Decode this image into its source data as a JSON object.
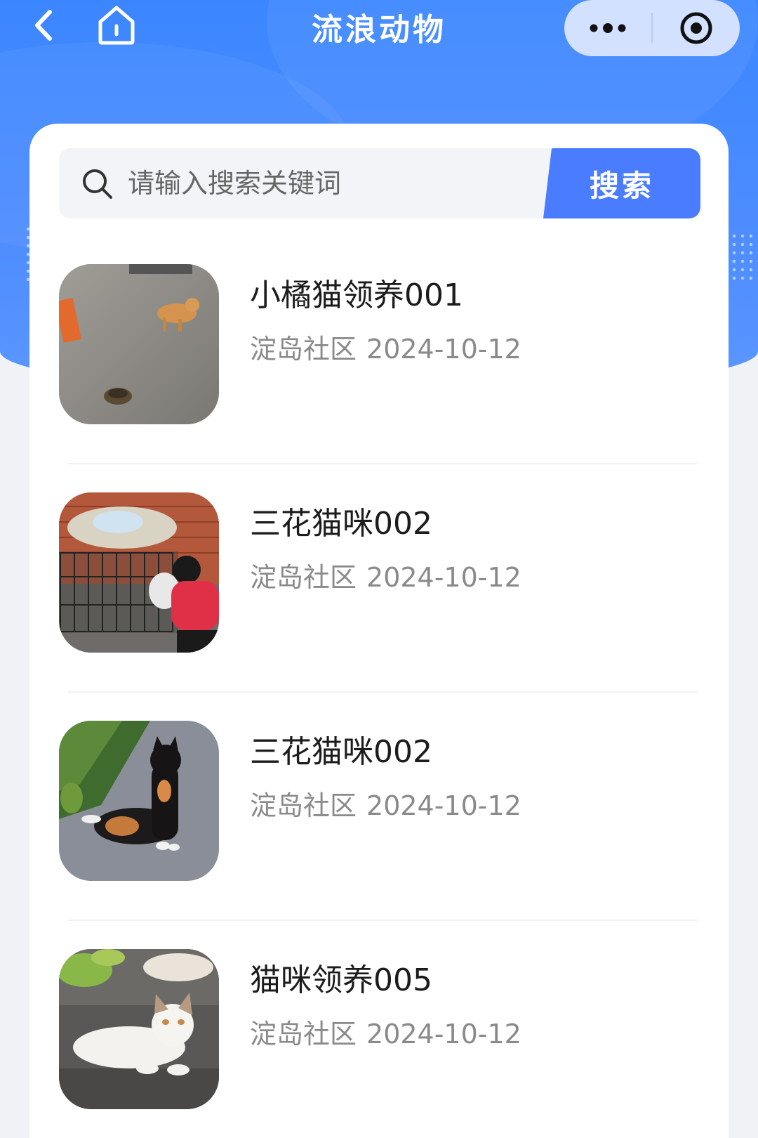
{
  "navbar": {
    "title": "流浪动物",
    "back_icon": "chevron-left-icon",
    "home_icon": "home-icon",
    "more_icon": "more-dots-icon",
    "close_icon": "record-target-icon"
  },
  "colors": {
    "header_blue": "#3b86ff",
    "search_button": "#4a7cff",
    "title_text": "#1c1c1c",
    "meta_text": "#8a8a8a"
  },
  "search": {
    "placeholder": "请输入搜索关键词",
    "button_label": "搜索",
    "icon": "search-icon"
  },
  "items": [
    {
      "title": "小橘猫领养001",
      "community": "淀岛社区",
      "date": "2024-10-12",
      "image": "orange-cat-photo"
    },
    {
      "title": "三花猫咪002",
      "community": "淀岛社区",
      "date": "2024-10-12",
      "image": "cat-cage-photo"
    },
    {
      "title": "三花猫咪002",
      "community": "淀岛社区",
      "date": "2024-10-12",
      "image": "calico-cat-photo"
    },
    {
      "title": "猫咪领养005",
      "community": "淀岛社区",
      "date": "2024-10-12",
      "image": "white-cat-photo"
    }
  ]
}
